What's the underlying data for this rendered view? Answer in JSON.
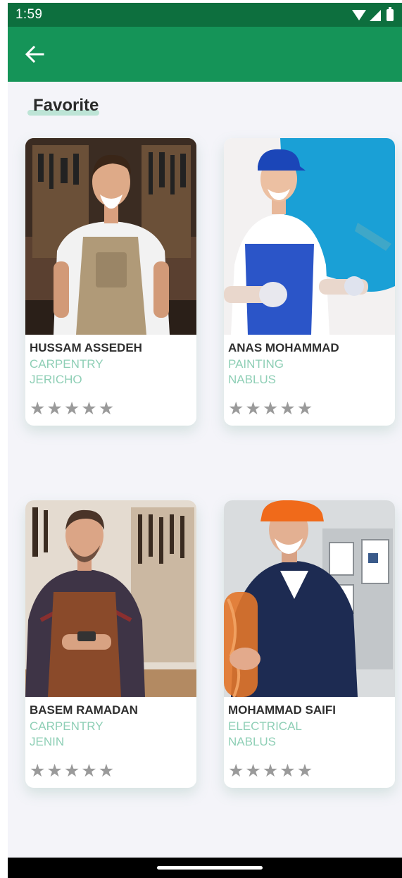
{
  "status_bar": {
    "time": "1:59"
  },
  "page": {
    "title": "Favorite"
  },
  "colors": {
    "status_bar": "#0d6f3e",
    "app_bar": "#159458",
    "accent_text": "#8fcfb6",
    "star": "#9a9a9a"
  },
  "workers": [
    {
      "name": "HUSSAM ASSEDEH",
      "service": "CARPENTRY",
      "city": "JERICHO",
      "rating": 0
    },
    {
      "name": "ANAS MOHAMMAD",
      "service": "PAINTING",
      "city": "NABLUS",
      "rating": 0
    },
    {
      "name": "BASEM RAMADAN",
      "service": "CARPENTRY",
      "city": "JENIN",
      "rating": 0
    },
    {
      "name": "MOHAMMAD SAIFI",
      "service": "ELECTRICAL",
      "city": "NABLUS",
      "rating": 0
    }
  ],
  "icons": {
    "back": "arrow-left-icon",
    "star": "star-icon"
  }
}
